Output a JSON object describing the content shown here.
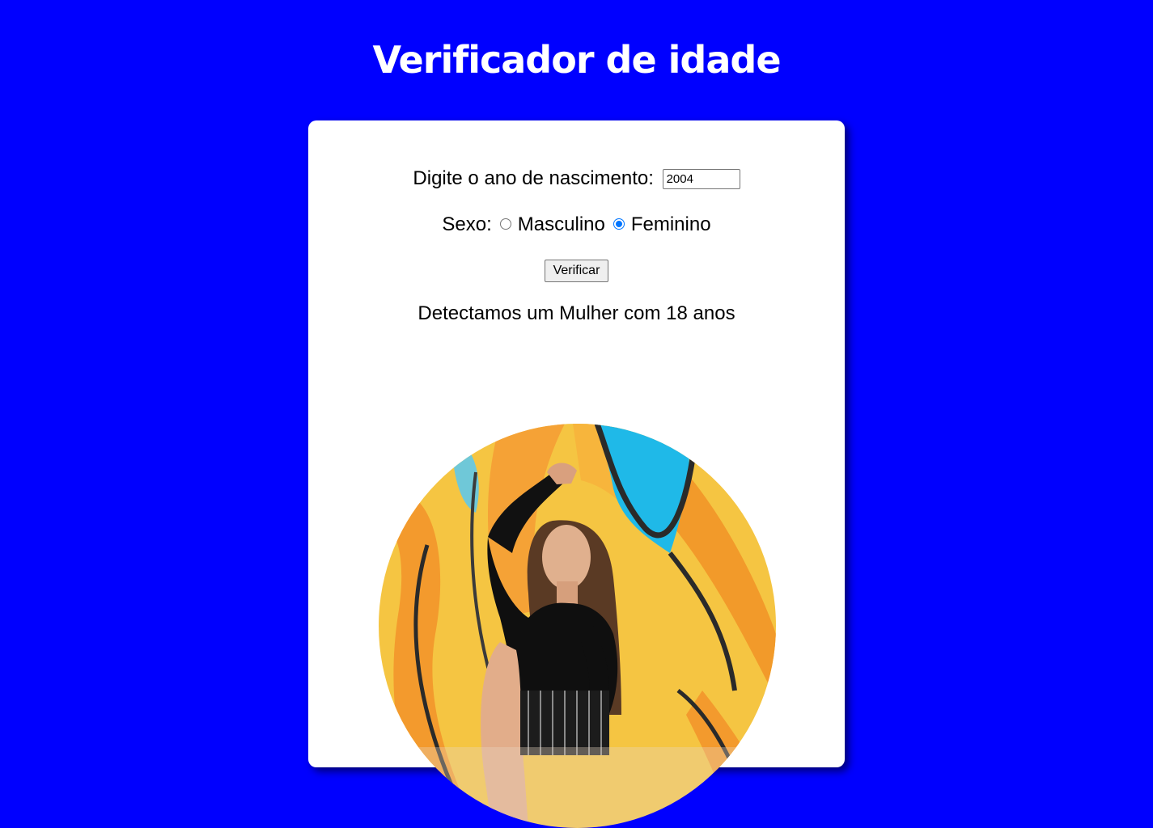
{
  "page": {
    "title": "Verificador de idade",
    "background_color": "#0000ff"
  },
  "form": {
    "year_label": "Digite o ano de nascimento:",
    "year_value": "2004",
    "sex_label": "Sexo:",
    "options": [
      {
        "label": "Masculino",
        "checked": false
      },
      {
        "label": "Feminino",
        "checked": true
      }
    ],
    "verify_label": "Verificar",
    "accent_color": "#0075ff"
  },
  "result": {
    "text": "Detectamos um Mulher com 18 anos",
    "image_subject": "young woman sitting in front of colorful graffiti wall"
  }
}
